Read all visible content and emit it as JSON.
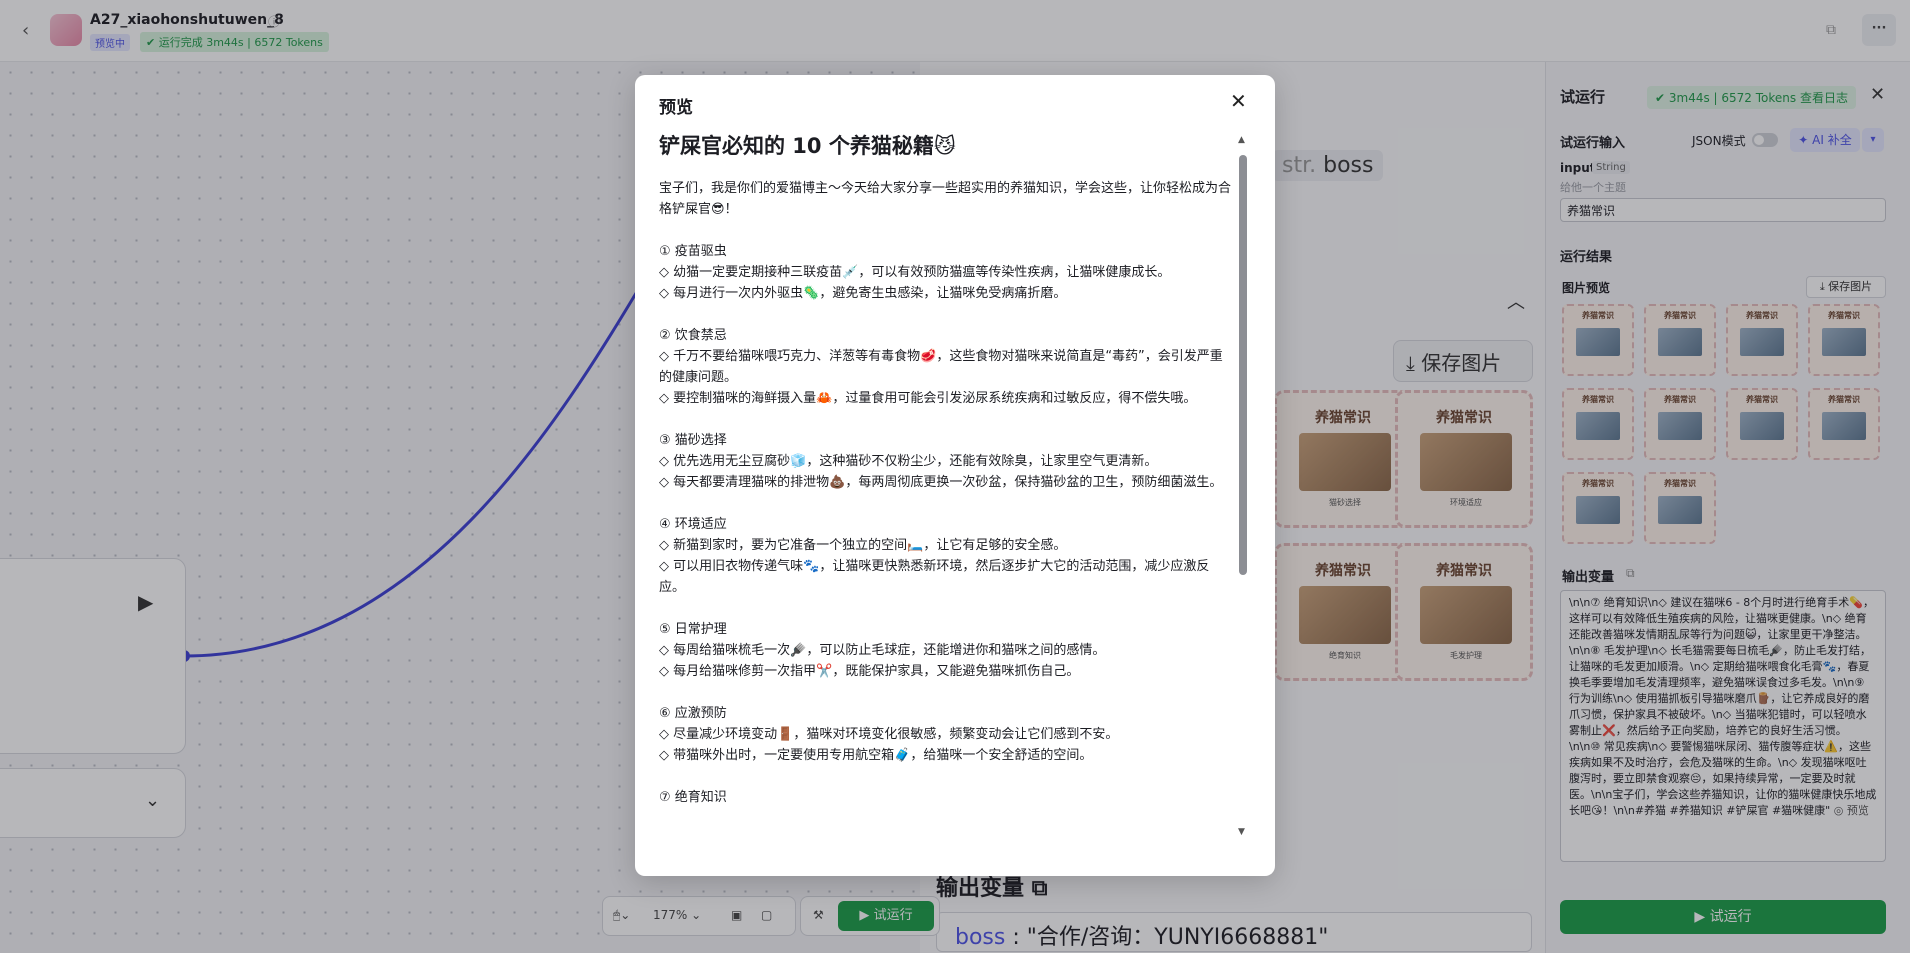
{
  "app": {
    "back": "‹",
    "title": "A27_xiaohonshutuwen_8",
    "preview_badge": "预览中",
    "run_badge": "运行完成 3m44s | 6572 Tokens",
    "more": "···"
  },
  "canvas": {
    "boss_chip_type": "str.",
    "boss_chip_name": "boss",
    "save_image": "保存图片",
    "cards": [
      {
        "title": "养猫常识",
        "caption": "猫砂选择"
      },
      {
        "title": "养猫常识",
        "caption": "环境适应"
      },
      {
        "title": "养猫常识",
        "caption": "绝育知识"
      },
      {
        "title": "养猫常识",
        "caption": "毛发护理"
      }
    ],
    "output_var_label": "输出变量",
    "boss_key": "boss",
    "boss_value": "\"合作/咨询：YUNYI6668881\""
  },
  "toolbar": {
    "zoom": "177%",
    "run": "试运行"
  },
  "panel": {
    "title": "试运行",
    "status": "3m44s | 6572 Tokens  查看日志",
    "input_section": "试运行输入",
    "json_mode": "JSON模式",
    "ai_fill": "AI 补全",
    "input_name": "input",
    "input_type": "String",
    "input_hint": "给他一个主题",
    "input_value": "养猫常识",
    "result_section": "运行结果",
    "image_preview": "图片预览",
    "save_image": "保存图片",
    "thumb_title": "养猫常识",
    "output_var": "输出变量",
    "output_text": "\\n\\n⑦ 绝育知识\\n◇ 建议在猫咪6 - 8个月时进行绝育手术💊，这样可以有效降低生殖疾病的风险，让猫咪更健康。\\n◇ 绝育还能改善猫咪发情期乱尿等行为问题😺，让家里更干净整洁。\\n\\n⑧ 毛发护理\\n◇ 长毛猫需要每日梳毛🪮，防止毛发打结，让猫咪的毛发更加顺滑。\\n◇ 定期给猫咪喂食化毛膏🐾，春夏换毛季要增加毛发清理频率，避免猫咪误食过多毛发。\\n\\n⑨ 行为训练\\n◇ 使用猫抓板引导猫咪磨爪🪵，让它养成良好的磨爪习惯，保护家具不被破坏。\\n◇ 当猫咪犯错时，可以轻喷水雾制止❌，然后给予正向奖励，培养它的良好生活习惯。\\n\\n⑩ 常见疾病\\n◇ 要警惕猫咪尿闭、猫传腹等症状⚠️，这些疾病如果不及时治疗，会危及猫咪的生命。\\n◇ 发现猫咪呕吐腹泻时，要立即禁食观察😔，如果持续异常，一定要及时就医。\\n\\n宝子们，学会这些养猫知识，让你的猫咪健康快乐地成长吧😘！\\n\\n#养猫 #养猫知识 #铲屎官 #猫咪健康\"",
    "output_preview": "◎ 预览",
    "run": "试运行"
  },
  "modal": {
    "title": "预览",
    "heading": "铲屎官必知的 10 个养猫秘籍😼",
    "intro": "宝子们，我是你们的爱猫博主～今天给大家分享一些超实用的养猫知识，学会这些，让你轻松成为合格铲屎官😎！",
    "sections": [
      {
        "title": "① 疫苗驱虫",
        "lines": [
          "◇ 幼猫一定要定期接种三联疫苗💉，可以有效预防猫瘟等传染性疾病，让猫咪健康成长。",
          "◇ 每月进行一次内外驱虫🦠，避免寄生虫感染，让猫咪免受病痛折磨。"
        ]
      },
      {
        "title": "② 饮食禁忌",
        "lines": [
          "◇ 千万不要给猫咪喂巧克力、洋葱等有毒食物🥩，这些食物对猫咪来说简直是“毒药”，会引发严重的健康问题。",
          "◇ 要控制猫咪的海鲜摄入量🦀，过量食用可能会引发泌尿系统疾病和过敏反应，得不偿失哦。"
        ]
      },
      {
        "title": "③ 猫砂选择",
        "lines": [
          "◇ 优先选用无尘豆腐砂🧊，这种猫砂不仅粉尘少，还能有效除臭，让家里空气更清新。",
          "◇ 每天都要清理猫咪的排泄物💩，每两周彻底更换一次砂盆，保持猫砂盆的卫生，预防细菌滋生。"
        ]
      },
      {
        "title": "④ 环境适应",
        "lines": [
          "◇ 新猫到家时，要为它准备一个独立的空间🛏️，让它有足够的安全感。",
          "◇ 可以用旧衣物传递气味🐾，让猫咪更快熟悉新环境，然后逐步扩大它的活动范围，减少应激反应。"
        ]
      },
      {
        "title": "⑤ 日常护理",
        "lines": [
          "◇ 每周给猫咪梳毛一次🪮，可以防止毛球症，还能增进你和猫咪之间的感情。",
          "◇ 每月给猫咪修剪一次指甲✂️，既能保护家具，又能避免猫咪抓伤自己。"
        ]
      },
      {
        "title": "⑥ 应激预防",
        "lines": [
          "◇ 尽量减少环境变动🚪，猫咪对环境变化很敏感，频繁变动会让它们感到不安。",
          "◇ 带猫咪外出时，一定要使用专用航空箱🧳，给猫咪一个安全舒适的空间。"
        ]
      },
      {
        "title": "⑦ 绝育知识",
        "lines": []
      }
    ]
  }
}
